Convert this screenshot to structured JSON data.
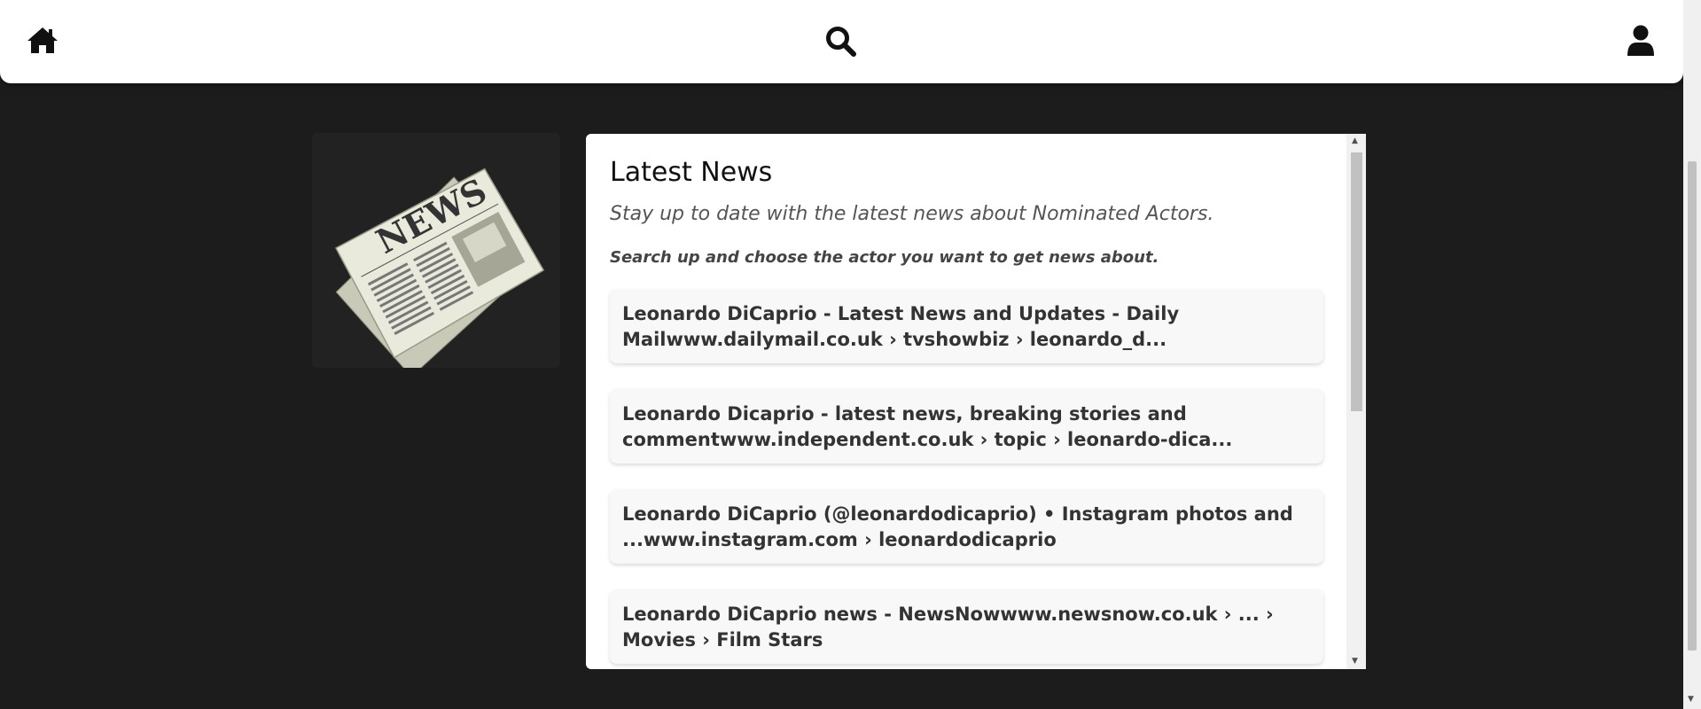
{
  "navbar": {
    "home_icon": "home-icon",
    "search_icon": "search-icon",
    "user_icon": "user-icon"
  },
  "illustration": {
    "masthead": "NEWS"
  },
  "news": {
    "title": "Latest News",
    "subtitle": "Stay up to date with the latest news about Nominated Actors.",
    "instruction": "Search up and choose the actor you want to get news about.",
    "items": [
      {
        "text": "Leonardo DiCaprio - Latest News and Updates - Daily Mailwww.dailymail.co.uk › tvshowbiz › leonardo_d..."
      },
      {
        "text": "Leonardo Dicaprio - latest news, breaking stories and commentwww.independent.co.uk › topic › leonardo-dica..."
      },
      {
        "text": "Leonardo DiCaprio (@leonardodicaprio) • Instagram photos and ...www.instagram.com › leonardodicaprio"
      },
      {
        "text": "Leonardo DiCaprio news - NewsNowwww.newsnow.co.uk › ... › Movies › Film Stars"
      }
    ]
  },
  "colors": {
    "background": "#1c1c1c",
    "navbar": "#ffffff",
    "panel": "#ffffff",
    "card": "#f8f8f8"
  }
}
